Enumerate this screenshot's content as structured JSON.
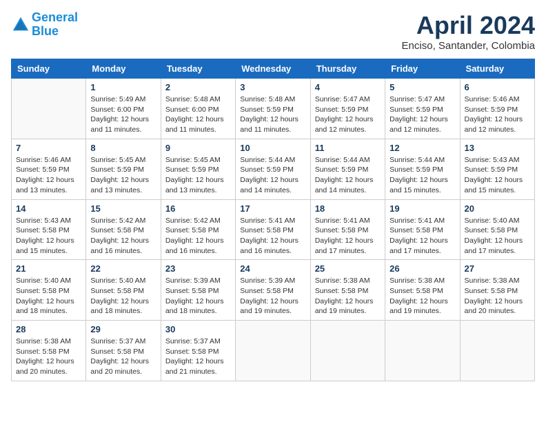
{
  "header": {
    "logo_line1": "General",
    "logo_line2": "Blue",
    "month_title": "April 2024",
    "subtitle": "Enciso, Santander, Colombia"
  },
  "days_of_week": [
    "Sunday",
    "Monday",
    "Tuesday",
    "Wednesday",
    "Thursday",
    "Friday",
    "Saturday"
  ],
  "weeks": [
    [
      {
        "day": "",
        "info": ""
      },
      {
        "day": "1",
        "info": "Sunrise: 5:49 AM\nSunset: 6:00 PM\nDaylight: 12 hours\nand 11 minutes."
      },
      {
        "day": "2",
        "info": "Sunrise: 5:48 AM\nSunset: 6:00 PM\nDaylight: 12 hours\nand 11 minutes."
      },
      {
        "day": "3",
        "info": "Sunrise: 5:48 AM\nSunset: 5:59 PM\nDaylight: 12 hours\nand 11 minutes."
      },
      {
        "day": "4",
        "info": "Sunrise: 5:47 AM\nSunset: 5:59 PM\nDaylight: 12 hours\nand 12 minutes."
      },
      {
        "day": "5",
        "info": "Sunrise: 5:47 AM\nSunset: 5:59 PM\nDaylight: 12 hours\nand 12 minutes."
      },
      {
        "day": "6",
        "info": "Sunrise: 5:46 AM\nSunset: 5:59 PM\nDaylight: 12 hours\nand 12 minutes."
      }
    ],
    [
      {
        "day": "7",
        "info": "Sunrise: 5:46 AM\nSunset: 5:59 PM\nDaylight: 12 hours\nand 13 minutes."
      },
      {
        "day": "8",
        "info": "Sunrise: 5:45 AM\nSunset: 5:59 PM\nDaylight: 12 hours\nand 13 minutes."
      },
      {
        "day": "9",
        "info": "Sunrise: 5:45 AM\nSunset: 5:59 PM\nDaylight: 12 hours\nand 13 minutes."
      },
      {
        "day": "10",
        "info": "Sunrise: 5:44 AM\nSunset: 5:59 PM\nDaylight: 12 hours\nand 14 minutes."
      },
      {
        "day": "11",
        "info": "Sunrise: 5:44 AM\nSunset: 5:59 PM\nDaylight: 12 hours\nand 14 minutes."
      },
      {
        "day": "12",
        "info": "Sunrise: 5:44 AM\nSunset: 5:59 PM\nDaylight: 12 hours\nand 15 minutes."
      },
      {
        "day": "13",
        "info": "Sunrise: 5:43 AM\nSunset: 5:59 PM\nDaylight: 12 hours\nand 15 minutes."
      }
    ],
    [
      {
        "day": "14",
        "info": "Sunrise: 5:43 AM\nSunset: 5:58 PM\nDaylight: 12 hours\nand 15 minutes."
      },
      {
        "day": "15",
        "info": "Sunrise: 5:42 AM\nSunset: 5:58 PM\nDaylight: 12 hours\nand 16 minutes."
      },
      {
        "day": "16",
        "info": "Sunrise: 5:42 AM\nSunset: 5:58 PM\nDaylight: 12 hours\nand 16 minutes."
      },
      {
        "day": "17",
        "info": "Sunrise: 5:41 AM\nSunset: 5:58 PM\nDaylight: 12 hours\nand 16 minutes."
      },
      {
        "day": "18",
        "info": "Sunrise: 5:41 AM\nSunset: 5:58 PM\nDaylight: 12 hours\nand 17 minutes."
      },
      {
        "day": "19",
        "info": "Sunrise: 5:41 AM\nSunset: 5:58 PM\nDaylight: 12 hours\nand 17 minutes."
      },
      {
        "day": "20",
        "info": "Sunrise: 5:40 AM\nSunset: 5:58 PM\nDaylight: 12 hours\nand 17 minutes."
      }
    ],
    [
      {
        "day": "21",
        "info": "Sunrise: 5:40 AM\nSunset: 5:58 PM\nDaylight: 12 hours\nand 18 minutes."
      },
      {
        "day": "22",
        "info": "Sunrise: 5:40 AM\nSunset: 5:58 PM\nDaylight: 12 hours\nand 18 minutes."
      },
      {
        "day": "23",
        "info": "Sunrise: 5:39 AM\nSunset: 5:58 PM\nDaylight: 12 hours\nand 18 minutes."
      },
      {
        "day": "24",
        "info": "Sunrise: 5:39 AM\nSunset: 5:58 PM\nDaylight: 12 hours\nand 19 minutes."
      },
      {
        "day": "25",
        "info": "Sunrise: 5:38 AM\nSunset: 5:58 PM\nDaylight: 12 hours\nand 19 minutes."
      },
      {
        "day": "26",
        "info": "Sunrise: 5:38 AM\nSunset: 5:58 PM\nDaylight: 12 hours\nand 19 minutes."
      },
      {
        "day": "27",
        "info": "Sunrise: 5:38 AM\nSunset: 5:58 PM\nDaylight: 12 hours\nand 20 minutes."
      }
    ],
    [
      {
        "day": "28",
        "info": "Sunrise: 5:38 AM\nSunset: 5:58 PM\nDaylight: 12 hours\nand 20 minutes."
      },
      {
        "day": "29",
        "info": "Sunrise: 5:37 AM\nSunset: 5:58 PM\nDaylight: 12 hours\nand 20 minutes."
      },
      {
        "day": "30",
        "info": "Sunrise: 5:37 AM\nSunset: 5:58 PM\nDaylight: 12 hours\nand 21 minutes."
      },
      {
        "day": "",
        "info": ""
      },
      {
        "day": "",
        "info": ""
      },
      {
        "day": "",
        "info": ""
      },
      {
        "day": "",
        "info": ""
      }
    ]
  ]
}
